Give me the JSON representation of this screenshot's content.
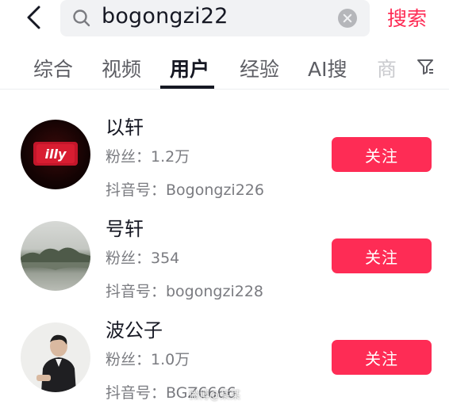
{
  "search": {
    "query": "bogongzi22",
    "submit_label": "搜索"
  },
  "tabs": [
    {
      "label": "综合"
    },
    {
      "label": "视频"
    },
    {
      "label": "用户"
    },
    {
      "label": "经验"
    },
    {
      "label": "AI搜"
    },
    {
      "label": "商"
    }
  ],
  "active_tab": "用户",
  "users": [
    {
      "name": "以轩",
      "fans": "粉丝：1.2万",
      "douyin_id": "抖音号：Bogongzi226",
      "follow_label": "关注",
      "avatar_text": "illy"
    },
    {
      "name": "号轩",
      "fans": "粉丝：354",
      "douyin_id": "抖音号：bogongzi228",
      "follow_label": "关注"
    },
    {
      "name": "波公子",
      "fans": "粉丝：1.0万",
      "douyin_id": "抖音号：BGZ6666",
      "follow_label": "关注"
    }
  ],
  "watermark": "微博@某某",
  "colors": {
    "accent": "#fe2c55",
    "text_primary": "#161823",
    "text_secondary": "#7a7b80",
    "search_bg": "#f1f2f4"
  },
  "icons": [
    "back-arrow-icon",
    "search-icon",
    "clear-icon",
    "filter-icon"
  ]
}
